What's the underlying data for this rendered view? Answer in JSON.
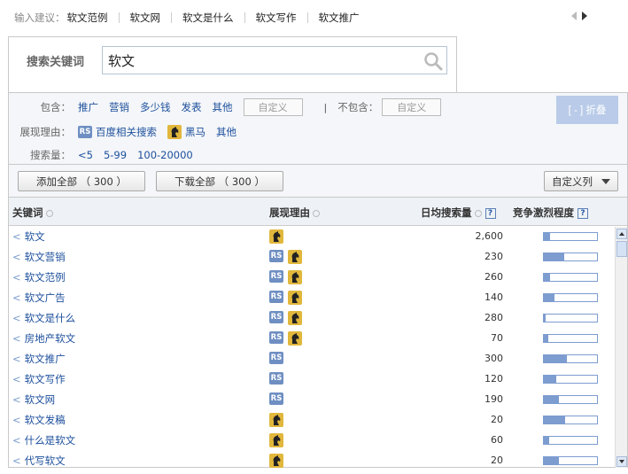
{
  "suggest": {
    "label": "输入建议：",
    "items": [
      "软文范例",
      "软文网",
      "软文是什么",
      "软文写作",
      "软文推广"
    ]
  },
  "search": {
    "label": "搜索关键词",
    "value": "软文"
  },
  "filters": {
    "include_label": "包含：",
    "include_items": [
      "推广",
      "营销",
      "多少钱",
      "发表",
      "其他"
    ],
    "custom_label": "自定义",
    "separator": "|",
    "exclude_label": "不包含：",
    "exclude_custom_label": "自定义",
    "reason_label": "展现理由：",
    "reason_items": [
      "百度相关搜索",
      "黑马",
      "其他"
    ],
    "volume_label": "搜索量：",
    "volume_items": [
      "<5",
      "5-99",
      "100-20000"
    ],
    "fold_label": "[ - ] 折叠"
  },
  "actions": {
    "add_all": "添加全部 （ 300 ）",
    "download_all": "下载全部 （ 300 ）",
    "custom_columns": "自定义列"
  },
  "table": {
    "headers": {
      "keyword": "关键词",
      "reason": "展现理由",
      "volume": "日均搜索量",
      "competition": "竞争激烈程度"
    },
    "rows": [
      {
        "keyword": "软文",
        "reasons": [
          "horse"
        ],
        "volume": "2,600",
        "competition": 0.12
      },
      {
        "keyword": "软文营销",
        "reasons": [
          "rs",
          "horse"
        ],
        "volume": "230",
        "competition": 0.38
      },
      {
        "keyword": "软文范例",
        "reasons": [
          "rs",
          "horse"
        ],
        "volume": "260",
        "competition": 0.12
      },
      {
        "keyword": "软文广告",
        "reasons": [
          "rs",
          "horse"
        ],
        "volume": "140",
        "competition": 0.2
      },
      {
        "keyword": "软文是什么",
        "reasons": [
          "rs",
          "horse"
        ],
        "volume": "280",
        "competition": 0.04
      },
      {
        "keyword": "房地产软文",
        "reasons": [
          "rs",
          "horse"
        ],
        "volume": "70",
        "competition": 0.08
      },
      {
        "keyword": "软文推广",
        "reasons": [
          "rs"
        ],
        "volume": "300",
        "competition": 0.44
      },
      {
        "keyword": "软文写作",
        "reasons": [
          "rs"
        ],
        "volume": "120",
        "competition": 0.24
      },
      {
        "keyword": "软文网",
        "reasons": [
          "rs"
        ],
        "volume": "190",
        "competition": 0.28
      },
      {
        "keyword": "软文发稿",
        "reasons": [
          "horse"
        ],
        "volume": "20",
        "competition": 0.4
      },
      {
        "keyword": "什么是软文",
        "reasons": [
          "horse"
        ],
        "volume": "60",
        "competition": 0.1
      },
      {
        "keyword": "代写软文",
        "reasons": [
          "horse"
        ],
        "volume": "20",
        "competition": 0.28
      }
    ]
  },
  "icons": {
    "rs_text": "RS",
    "help_text": "?",
    "row_marker": "<"
  },
  "colors": {
    "link": "#1c4f9c",
    "rs_badge": "#6f8fc2",
    "horse_badge": "#e1b73c",
    "bar": "#7d9cd0"
  }
}
